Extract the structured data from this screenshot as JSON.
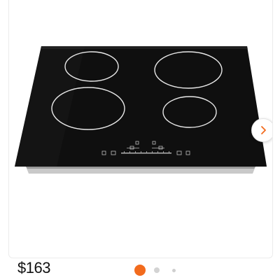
{
  "product": {
    "price": "$163",
    "image_icon": "induction-cooktop-image"
  },
  "carousel": {
    "next_icon": "chevron-right-icon",
    "page_count": 3,
    "active_index": 0
  },
  "colors": {
    "accent": "#f26b1d",
    "dot_inactive": "#d3d3d3",
    "dot_small": "#cfcfcf",
    "cooktop_glass": "#0f0f0f",
    "chevron": "#f26b1d"
  }
}
